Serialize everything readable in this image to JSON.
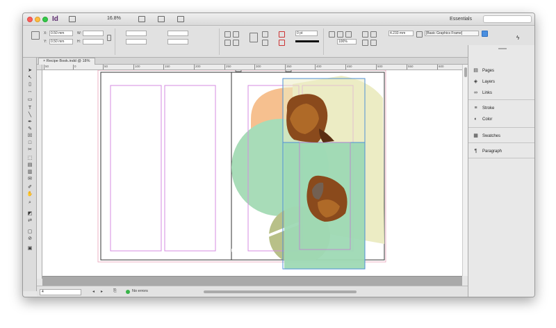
{
  "app": {
    "logo": "Id",
    "zoom": "16.8%",
    "workspace": "Essentials",
    "workspace_caret": "⌃"
  },
  "document": {
    "tab_title": "Recipe Book.indd @ 18%",
    "close_glyph": "×"
  },
  "control_panel": {
    "x_label": "X:",
    "y_label": "Y:",
    "w_label": "W:",
    "h_label": "H:",
    "x_value": "0.50 mm",
    "y_value": "0.50 mm",
    "stroke_weight": "0 pt",
    "fit_percent": "100%",
    "frame_style": "[Basic Graphics Frame]",
    "ref_value": "4.233 mm"
  },
  "ruler": {
    "ticks": [
      "50",
      "0",
      "50",
      "100",
      "150",
      "200",
      "250",
      "300",
      "350",
      "400",
      "450",
      "500",
      "550",
      "600"
    ]
  },
  "status": {
    "page": "4",
    "prev_glyph": "◂",
    "next_glyph": "▸",
    "preflight": "No errors"
  },
  "panels": {
    "items": [
      {
        "label": "Pages",
        "icon": "pages-icon",
        "glyph": "▤"
      },
      {
        "label": "Layers",
        "icon": "layers-icon",
        "glyph": "◈"
      },
      {
        "label": "Links",
        "icon": "links-icon",
        "glyph": "∞"
      },
      {
        "label": "Stroke",
        "icon": "stroke-icon",
        "glyph": "≡"
      },
      {
        "label": "Color",
        "icon": "color-icon",
        "glyph": "◐"
      },
      {
        "label": "Swatches",
        "icon": "swatches-icon",
        "glyph": "▦"
      },
      {
        "label": "Paragraph",
        "icon": "paragraph-icon",
        "glyph": "¶"
      }
    ]
  },
  "tools": [
    {
      "name": "selection-tool-icon",
      "glyph": "➤"
    },
    {
      "name": "direct-selection-tool-icon",
      "glyph": "↖"
    },
    {
      "name": "page-tool-icon",
      "glyph": "▯"
    },
    {
      "name": "gap-tool-icon",
      "glyph": "↔"
    },
    {
      "name": "content-collector-icon",
      "glyph": "▭"
    },
    {
      "name": "type-tool-icon",
      "glyph": "T"
    },
    {
      "name": "line-tool-icon",
      "glyph": "╲"
    },
    {
      "name": "pen-tool-icon",
      "glyph": "✒"
    },
    {
      "name": "pencil-tool-icon",
      "glyph": "✎"
    },
    {
      "name": "rectangle-frame-tool-icon",
      "glyph": "☒"
    },
    {
      "name": "rectangle-tool-icon",
      "glyph": "□"
    },
    {
      "name": "scissors-tool-icon",
      "glyph": "✂"
    },
    {
      "name": "free-transform-tool-icon",
      "glyph": "⬚"
    },
    {
      "name": "gradient-swatch-tool-icon",
      "glyph": "▤"
    },
    {
      "name": "gradient-feather-tool-icon",
      "glyph": "▥"
    },
    {
      "name": "note-tool-icon",
      "glyph": "✉"
    },
    {
      "name": "eyedropper-tool-icon",
      "glyph": "✐"
    },
    {
      "name": "hand-tool-icon",
      "glyph": "✋"
    },
    {
      "name": "zoom-tool-icon",
      "glyph": "⌕"
    },
    {
      "name": "fill-stroke-icon",
      "glyph": "◩"
    },
    {
      "name": "swap-fill-stroke-icon",
      "glyph": "⇄"
    },
    {
      "name": "formatting-affects-container-icon",
      "glyph": "▢"
    },
    {
      "name": "apply-none-icon",
      "glyph": "⊘"
    },
    {
      "name": "screen-mode-icon",
      "glyph": "▣"
    }
  ],
  "colors": {
    "margin_guide": "#d48be0",
    "bleed": "#e8a0b8",
    "selection": "#4e8fd6",
    "orange_shape": "#f6c08f",
    "pale_yellow_shape": "#ececc4",
    "mint_circle": "#a8dcb8",
    "olive_shape": "#b8c088",
    "green_frame_fill": "#9ed9b4",
    "food_image": "#8a4a1c"
  }
}
